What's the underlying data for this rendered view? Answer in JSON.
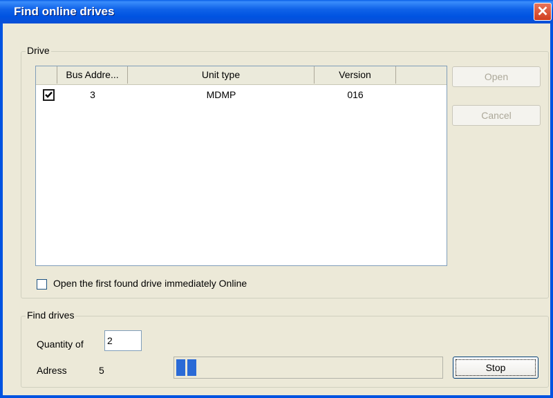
{
  "window": {
    "title": "Find online drives",
    "close_icon": "close-icon"
  },
  "drive_group": {
    "label": "Drive",
    "columns": [
      "Bus Addre...",
      "Unit type",
      "Version",
      ""
    ],
    "rows": [
      {
        "checked": true,
        "bus_address": "3",
        "unit_type": "MDMP",
        "version": "016"
      }
    ],
    "open_first_label": "Open the first found drive immediately Online",
    "open_first_checked": false
  },
  "buttons": {
    "open": "Open",
    "cancel": "Cancel",
    "stop": "Stop"
  },
  "find_group": {
    "label": "Find drives",
    "quantity_label": "Quantity of",
    "quantity_value": "2",
    "address_label": "Adress",
    "address_value": "5",
    "progress_blocks": 2
  },
  "colors": {
    "title_bar": "#0053e1",
    "progress": "#2a6ad6",
    "close_button": "#cf3d1f"
  }
}
